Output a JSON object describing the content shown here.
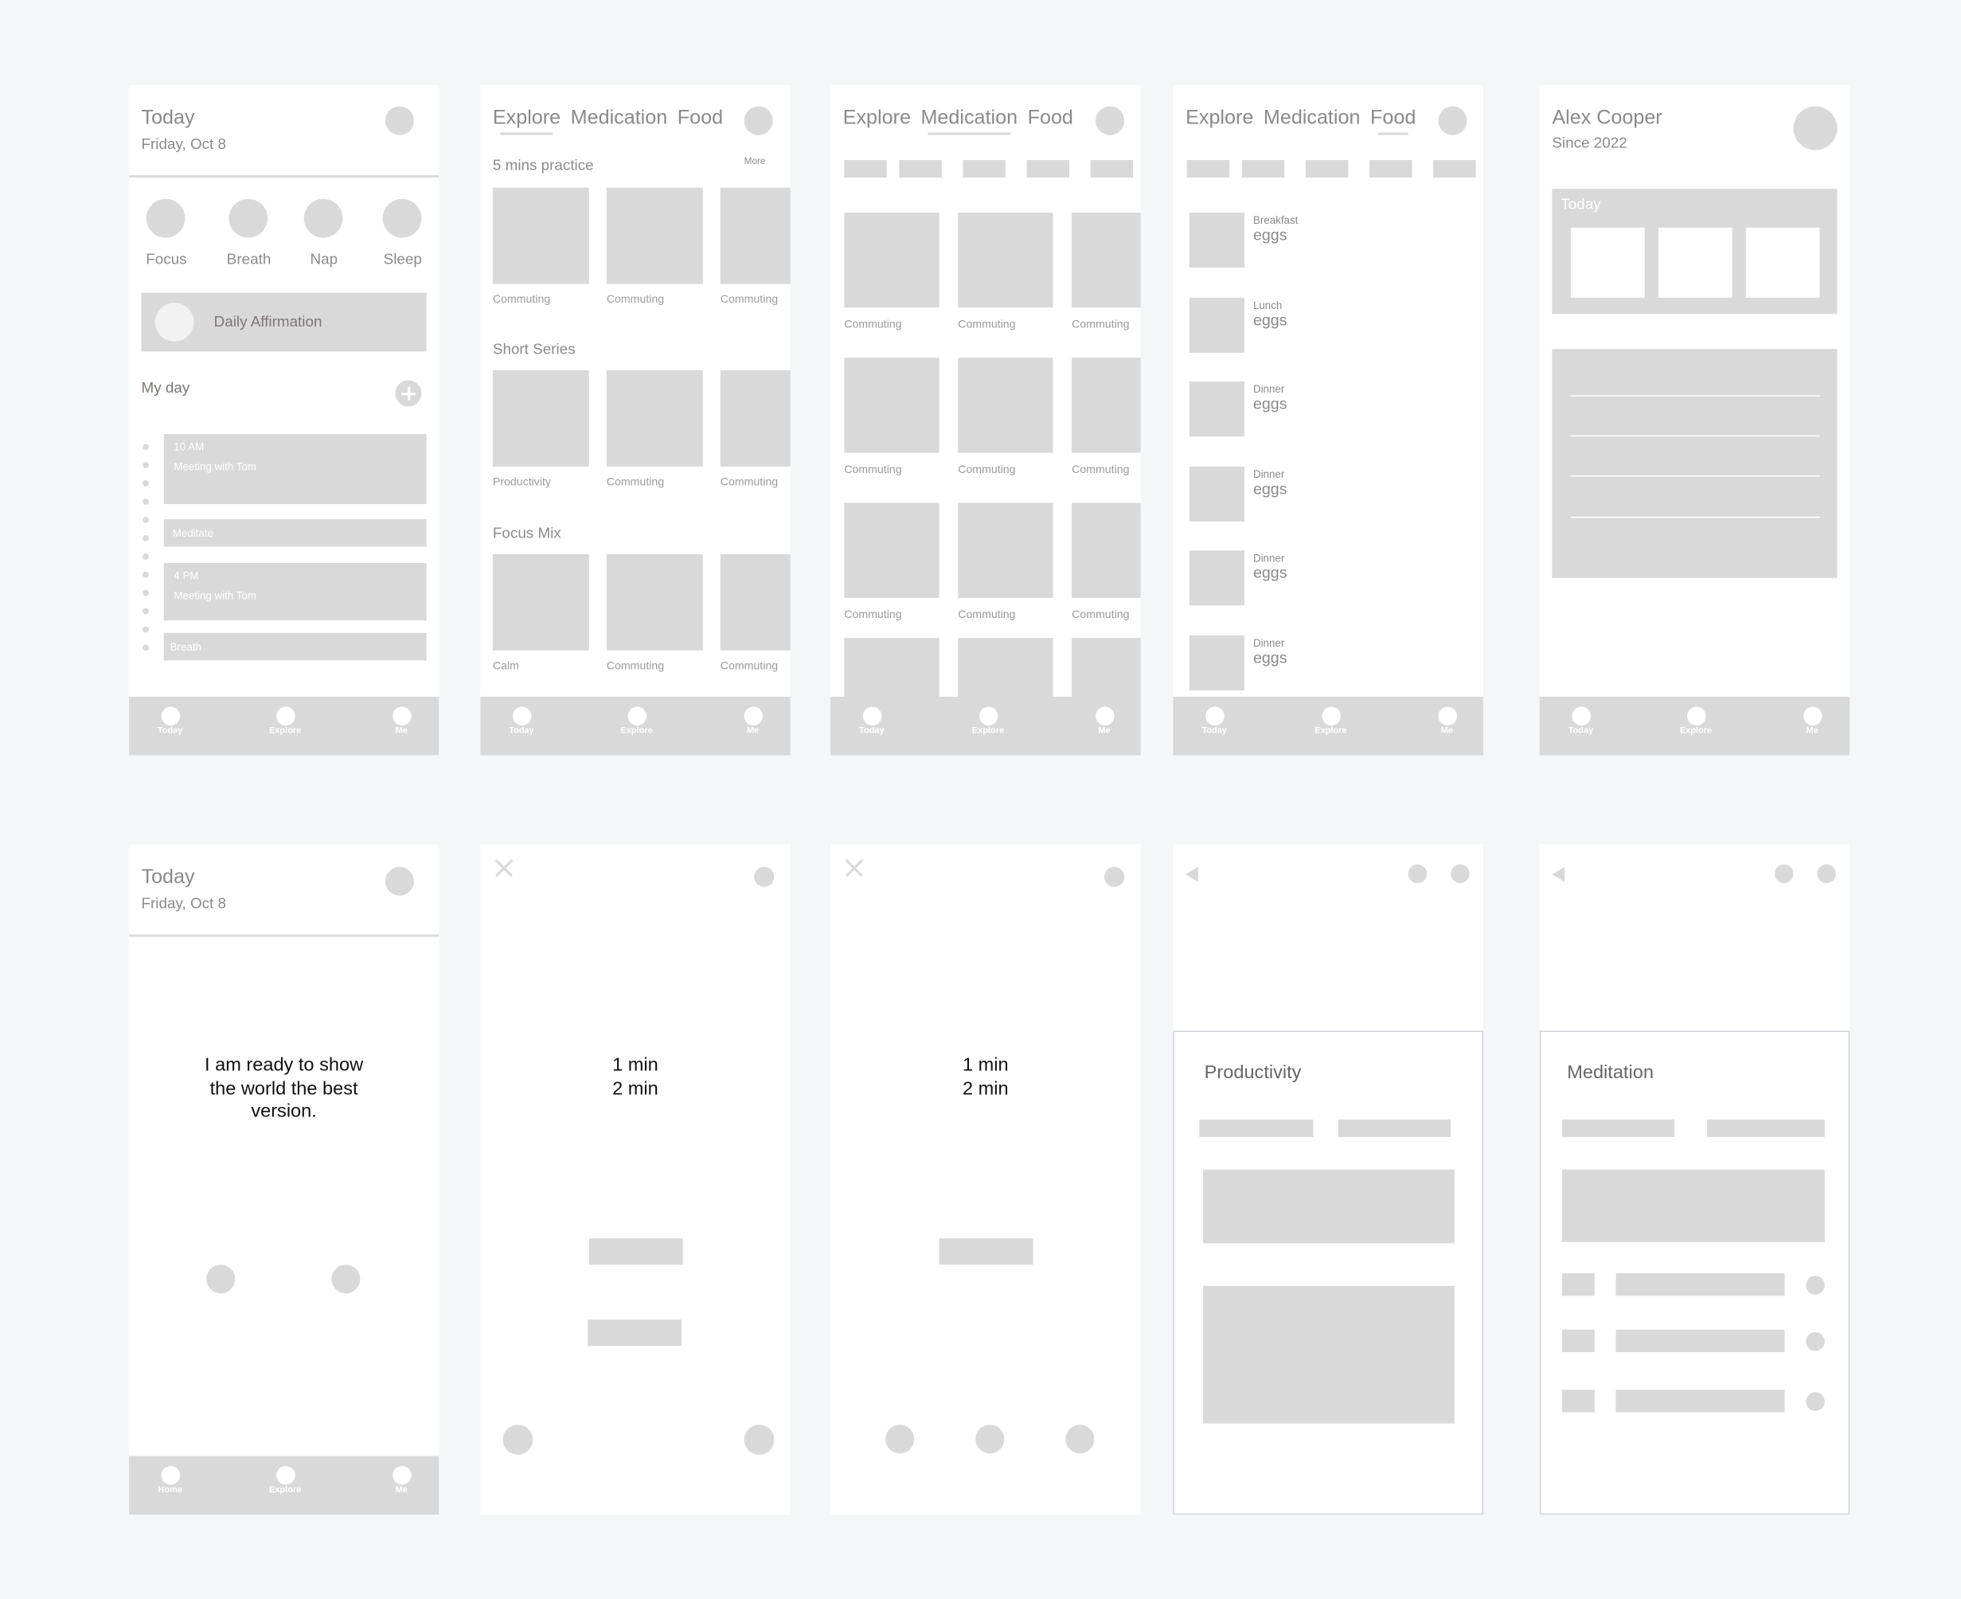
{
  "today_screen": {
    "title": "Today",
    "date": "Friday, Oct 8",
    "quick_actions": [
      "Focus",
      "Breath",
      "Nap",
      "Sleep"
    ],
    "affirmation_label": "Daily Affirmation",
    "my_day_label": "My day",
    "schedule": [
      {
        "time": "10 AM",
        "title": "Meeting with Tom"
      },
      {
        "time": "",
        "title": "Meditate"
      },
      {
        "time": "4 PM",
        "title": "Meeting with Tom"
      },
      {
        "time": "",
        "title": "Breath"
      }
    ]
  },
  "tabbar": {
    "today": "Today",
    "home": "Home",
    "explore": "Explore",
    "me": "Me"
  },
  "top_tabs": {
    "explore": "Explore",
    "medication": "Medication",
    "food": "Food"
  },
  "explore_screen": {
    "more_label": "More",
    "sections": [
      {
        "title": "5 mins practice",
        "items": [
          "Commuting",
          "Commuting",
          "Commuting"
        ]
      },
      {
        "title": "Short Series",
        "items": [
          "Productivity",
          "Commuting",
          "Commuting"
        ]
      },
      {
        "title": "Focus Mix",
        "items": [
          "Calm",
          "Commuting",
          "Commuting"
        ]
      }
    ]
  },
  "medication_screen": {
    "rows": [
      [
        "Commuting",
        "Commuting",
        "Commuting"
      ],
      [
        "Commuting",
        "Commuting",
        "Commuting"
      ],
      [
        "Commuting",
        "Commuting",
        "Commuting"
      ]
    ]
  },
  "food_screen": {
    "meals": [
      {
        "meal": "Breakfast",
        "food": "eggs"
      },
      {
        "meal": "Lunch",
        "food": "eggs"
      },
      {
        "meal": "Dinner",
        "food": "eggs"
      },
      {
        "meal": "Dinner",
        "food": "eggs"
      },
      {
        "meal": "Dinner",
        "food": "eggs"
      },
      {
        "meal": "Dinner",
        "food": "eggs"
      }
    ]
  },
  "profile_screen": {
    "name": "Alex Cooper",
    "since": "Since 2022",
    "today_label": "Today"
  },
  "affirmation_screen": {
    "title": "Today",
    "date": "Friday, Oct 8",
    "text": "I am ready to show the world the best version."
  },
  "timer_screen": {
    "option1": "1 min",
    "option2": "2 min"
  },
  "detail_productivity": {
    "title": "Productivity"
  },
  "detail_meditation": {
    "title": "Meditation"
  }
}
